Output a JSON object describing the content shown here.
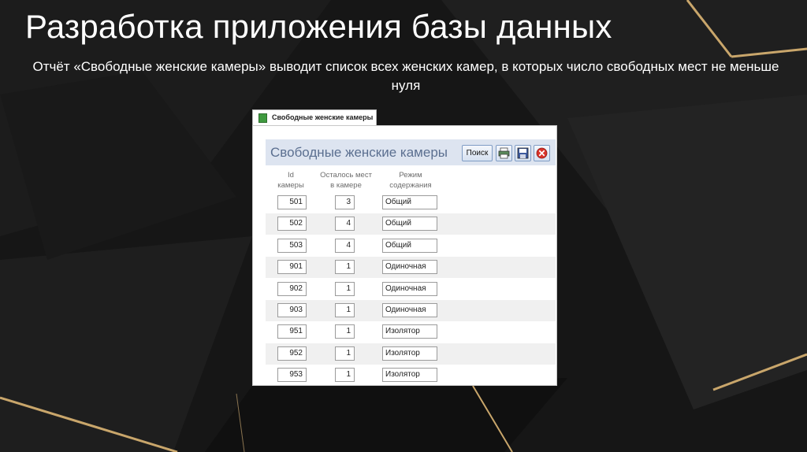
{
  "slide": {
    "title": "Разработка приложения базы данных",
    "subtitle": "Отчёт «Свободные женские камеры» выводит список всех женских камер, в которых число свободных мест не меньше нуля"
  },
  "window": {
    "tab_label": "Свободные женские камеры",
    "report_title": "Свободные женские камеры",
    "search_label": "Поиск",
    "icons": [
      "print-icon",
      "save-icon",
      "close-icon"
    ]
  },
  "table": {
    "columns": [
      "Id камеры",
      "Осталось мест в камере",
      "Режим содержания"
    ],
    "column_lines": [
      [
        "Id",
        "камеры"
      ],
      [
        "Осталось мест",
        "в камере"
      ],
      [
        "Режим",
        "содержания"
      ]
    ],
    "rows": [
      [
        "501",
        "3",
        "Общий"
      ],
      [
        "502",
        "4",
        "Общий"
      ],
      [
        "503",
        "4",
        "Общий"
      ],
      [
        "901",
        "1",
        "Одиночная"
      ],
      [
        "902",
        "1",
        "Одиночная"
      ],
      [
        "903",
        "1",
        "Одиночная"
      ],
      [
        "951",
        "1",
        "Изолятор"
      ],
      [
        "952",
        "1",
        "Изолятор"
      ],
      [
        "953",
        "1",
        "Изолятор"
      ]
    ]
  },
  "colors": {
    "background": "#141414",
    "accent_gold": "#c9a66b",
    "header_band": "#dde4f0",
    "report_title": "#5b6f90"
  }
}
